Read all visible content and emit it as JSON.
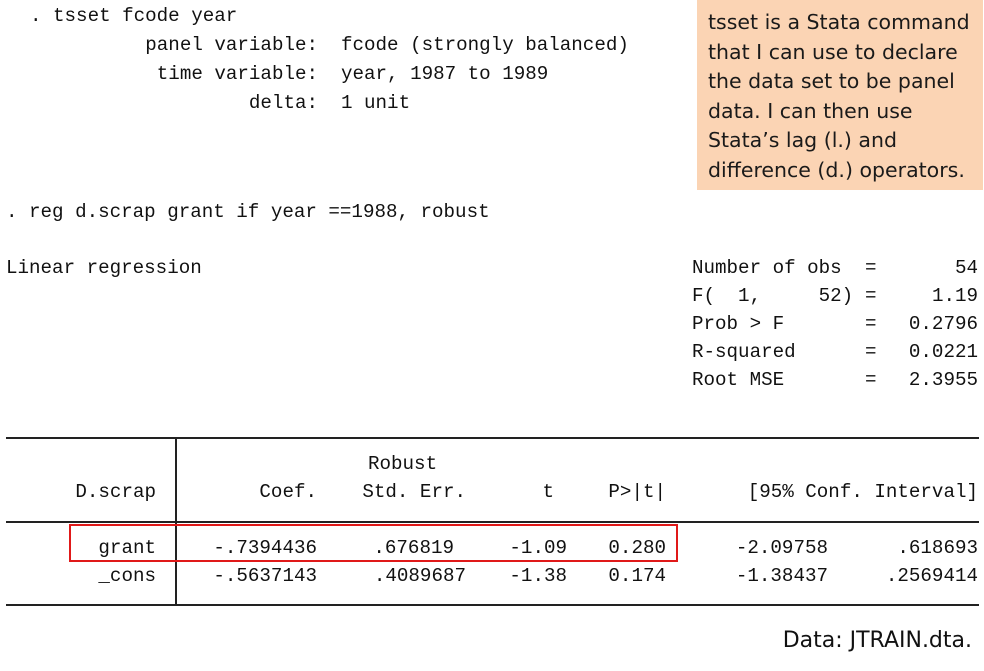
{
  "tsset": {
    "command": ". tsset fcode year",
    "panel_label": "panel variable:",
    "panel_value": "fcode (strongly balanced)",
    "time_label": "time variable:",
    "time_value": "year, 1987 to 1989",
    "delta_label": "delta:",
    "delta_value": "1 unit"
  },
  "callout": {
    "lines": [
      "tsset is a Stata command",
      "that I can use to declare",
      "the data set to be panel",
      "data. I can then use",
      "Stata’s lag (l.) and",
      "difference (d.) operators."
    ],
    "bg_color": "#fbd4b4"
  },
  "reg": {
    "command": ". reg d.scrap grant if year ==1988, robust",
    "title": "Linear regression",
    "stats": [
      {
        "label": "Number of obs",
        "eq": "=",
        "value": "54"
      },
      {
        "label": "F(  1,     52)",
        "eq": "=",
        "value": "1.19"
      },
      {
        "label": "Prob > F",
        "eq": "=",
        "value": "0.2796"
      },
      {
        "label": "R-squared",
        "eq": "=",
        "value": "0.0221"
      },
      {
        "label": "Root MSE",
        "eq": "=",
        "value": "2.3955"
      }
    ]
  },
  "table": {
    "depvar": "D.scrap",
    "robust": "Robust",
    "headers": {
      "coef": "Coef.",
      "se": "Std. Err.",
      "t": "t",
      "p": "P>|t|",
      "ci": "[95% Conf. Interval]"
    },
    "rows": [
      {
        "name": "grant",
        "coef": "-.7394436",
        "se": ".676819",
        "t": "-1.09",
        "p": "0.280",
        "lo": "-2.09758",
        "hi": ".618693"
      },
      {
        "name": "_cons",
        "coef": "-.5637143",
        "se": ".4089687",
        "t": "-1.38",
        "p": "0.174",
        "lo": "-1.38437",
        "hi": ".2569414"
      }
    ],
    "highlight_color": "#e01919"
  },
  "source": "Data: JTRAIN.dta."
}
